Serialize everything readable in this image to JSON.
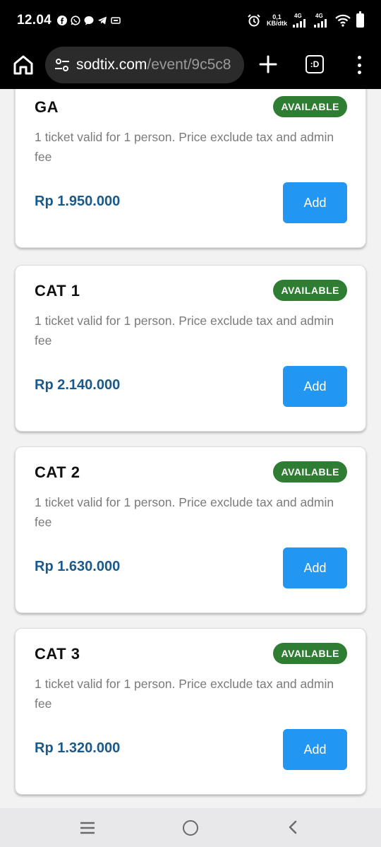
{
  "status_bar": {
    "time": "12.04",
    "net_speed_value": "0,1",
    "net_speed_unit": "KB/dtk",
    "signal1_label": "4G",
    "signal2_label": "4G"
  },
  "browser": {
    "url_host": "sodtix.com",
    "url_path": "/event/9c5c8",
    "tab_label": ":D"
  },
  "tickets": [
    {
      "name": "GA",
      "status": "AVAILABLE",
      "description": "1 ticket valid for 1 person. Price exclude tax and admin fee",
      "price": "Rp 1.950.000",
      "button": "Add"
    },
    {
      "name": "CAT 1",
      "status": "AVAILABLE",
      "description": "1 ticket valid for 1 person. Price exclude tax and admin fee",
      "price": "Rp 2.140.000",
      "button": "Add"
    },
    {
      "name": "CAT 2",
      "status": "AVAILABLE",
      "description": "1 ticket valid for 1 person. Price exclude tax and admin fee",
      "price": "Rp 1.630.000",
      "button": "Add"
    },
    {
      "name": "CAT 3",
      "status": "AVAILABLE",
      "description": "1 ticket valid for 1 person. Price exclude tax and admin fee",
      "price": "Rp 1.320.000",
      "button": "Add"
    }
  ],
  "colors": {
    "badge": "#2e7d32",
    "button": "#2196f3",
    "price": "#1a5a8a"
  },
  "icons": {
    "status_left": [
      "facebook-icon",
      "whatsapp-icon",
      "chat-icon",
      "telegram-icon",
      "cast-icon"
    ],
    "status_right": [
      "alarm-icon",
      "signal-icon",
      "signal-icon",
      "wifi-icon",
      "battery-icon"
    ],
    "browser": [
      "home-icon",
      "tune-icon",
      "plus-icon",
      "tab-switcher-icon",
      "more-vert-icon"
    ],
    "nav": [
      "recent-apps-icon",
      "home-circle-icon",
      "back-chevron-icon"
    ]
  }
}
